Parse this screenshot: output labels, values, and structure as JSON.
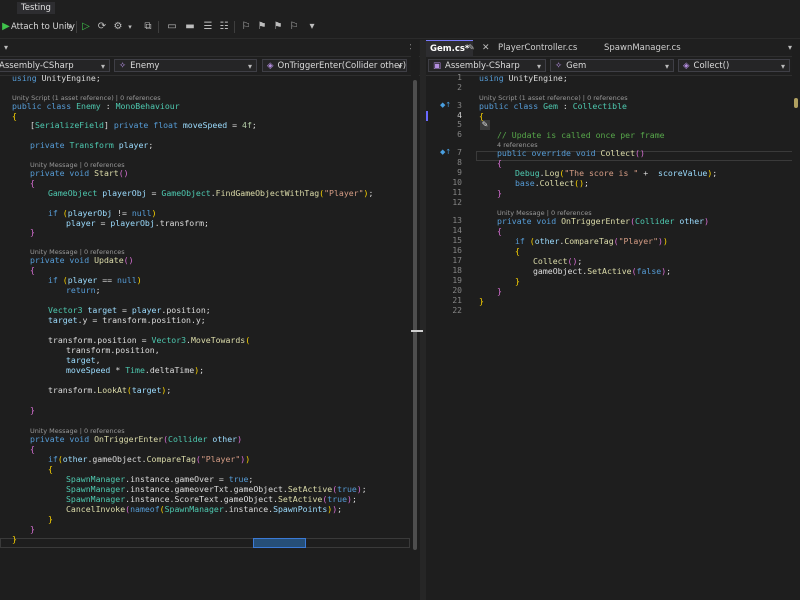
{
  "menu": {
    "testing": "Testing"
  },
  "toolbar": {
    "attach": "Attach to Unity"
  },
  "left": {
    "project": "Assembly-CSharp",
    "class": "Enemy",
    "member": "OnTriggerEnter(Collider other)"
  },
  "right": {
    "tabs": [
      "Gem.cs*",
      "PlayerController.cs",
      "SpawnManager.cs"
    ],
    "project": "Assembly-CSharp",
    "class": "Gem",
    "member": "Collect()"
  },
  "left_lens": [
    "Unity Script (1 asset reference) | 0 references",
    "Unity Message | 0 references",
    "Unity Message | 0 references",
    "Unity Message | 0 references"
  ],
  "right_lens": [
    "Unity Script (1 asset reference) | 0 references",
    "4 references",
    "Unity Message | 0 references"
  ],
  "right_line_numbers": [
    "1",
    "2",
    "3",
    "4",
    "5",
    "6",
    "7",
    "8",
    "9",
    "10",
    "11",
    "12",
    "13",
    "14",
    "15",
    "16",
    "17",
    "18",
    "19",
    "20",
    "21",
    "22"
  ]
}
